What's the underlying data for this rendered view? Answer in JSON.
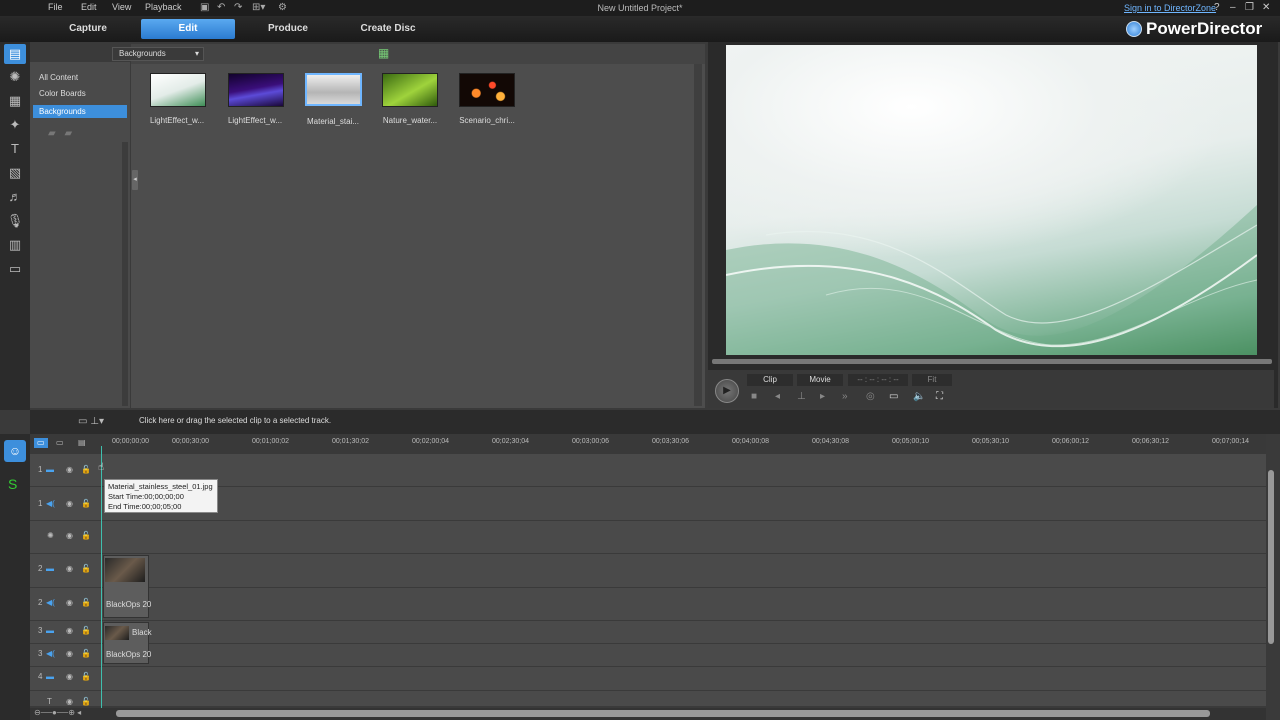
{
  "menu": [
    "File",
    "Edit",
    "View",
    "Playback"
  ],
  "window_title": "New Untitled Project*",
  "sign_in": "Sign in to DirectorZone",
  "window_buttons": [
    "?",
    "–",
    "❐",
    "✕"
  ],
  "modes": [
    "Capture",
    "Edit",
    "Produce",
    "Create Disc"
  ],
  "active_mode": "Edit",
  "brand": "PowerDirector",
  "library": {
    "tree": [
      "All Content",
      "Color Boards",
      "Backgrounds"
    ],
    "selected": "Backgrounds",
    "category": "Backgrounds",
    "items": [
      {
        "label": "LightEffect_w..."
      },
      {
        "label": "LightEffect_w..."
      },
      {
        "label": "Material_stai..."
      },
      {
        "label": "Nature_water..."
      },
      {
        "label": "Scenario_chri..."
      }
    ]
  },
  "preview": {
    "segments": [
      "Clip",
      "Movie"
    ],
    "timecode": "-- : -- : -- : --",
    "zoom": "Fit"
  },
  "timeline": {
    "hint": "Click here or drag the selected clip to a selected track.",
    "ticks": [
      "00;00;00;00",
      "00;00;30;00",
      "00;01;00;02",
      "00;01;30;02",
      "00;02;00;04",
      "00;02;30;04",
      "00;03;00;06",
      "00;03;30;06",
      "00;04;00;08",
      "00;04;30;08",
      "00;05;00;10",
      "00;05;30;10",
      "00;06;00;12",
      "00;06;30;12",
      "00;07;00;14"
    ],
    "track_numbers": [
      "1",
      "1",
      "2",
      "2",
      "3",
      "3",
      "4",
      "4"
    ],
    "clips": [
      {
        "label": "BlackOps 20"
      },
      {
        "label": "Black"
      },
      {
        "label": "BlackOps 20"
      }
    ],
    "tooltip": {
      "file": "Material_stainless_steel_01.jpg",
      "start": "Start Time:00;00;00;00",
      "end": "End Time:00;00;05;00"
    }
  }
}
